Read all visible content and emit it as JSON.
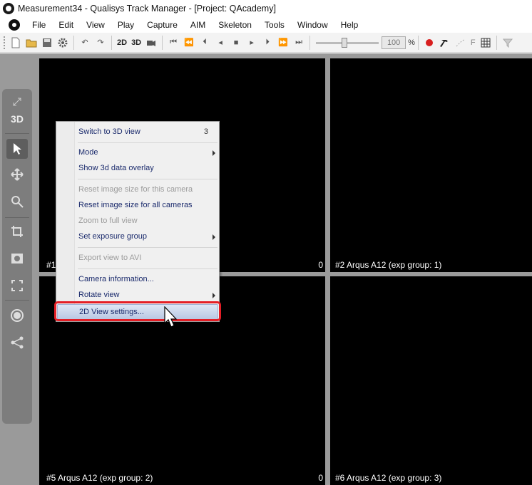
{
  "window": {
    "title": "Measurement34 - Qualisys Track Manager - [Project: QAcademy]"
  },
  "menubar": {
    "items": [
      "File",
      "Edit",
      "View",
      "Play",
      "Capture",
      "AIM",
      "Skeleton",
      "Tools",
      "Window",
      "Help"
    ]
  },
  "toolbar": {
    "btn_2d": "2D",
    "btn_3d": "3D",
    "zoom_value": "100",
    "zoom_unit": "%",
    "btn_f": "F"
  },
  "sidepanel": {
    "label_3d": "3D"
  },
  "views": [
    {
      "label": "#1",
      "count": "0"
    },
    {
      "label": "#2 Arqus A12 (exp group: 1)",
      "count": ""
    },
    {
      "label": "#5 Arqus A12 (exp group: 2)",
      "count": "0"
    },
    {
      "label": "#6 Arqus A12 (exp group: 3)",
      "count": ""
    }
  ],
  "context_menu": {
    "items": [
      {
        "label": "Switch to 3D view",
        "shortcut": "3"
      },
      {
        "label": "Mode"
      },
      {
        "label": "Show 3d data overlay"
      },
      {
        "label": "Reset image size for this camera"
      },
      {
        "label": "Reset image size for all cameras"
      },
      {
        "label": "Zoom to full view"
      },
      {
        "label": "Set exposure group"
      },
      {
        "label": "Export view to AVI"
      },
      {
        "label": "Camera information..."
      },
      {
        "label": "Rotate view"
      },
      {
        "label": "2D View settings..."
      }
    ]
  },
  "colors": {
    "highlight_ring": "#e41e26",
    "menu_text": "#1a2a6c",
    "disabled_text": "#9b9b9b"
  }
}
